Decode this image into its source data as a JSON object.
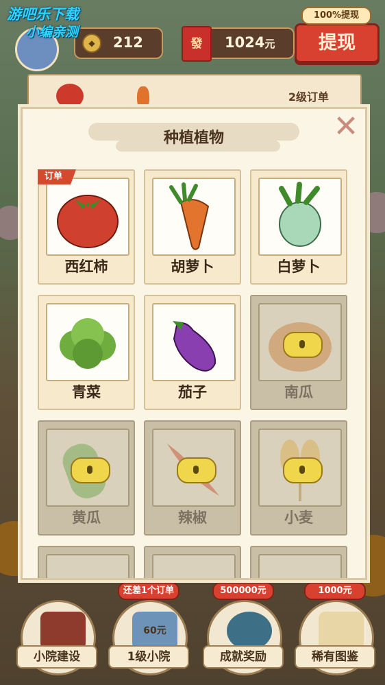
{
  "watermark": {
    "line1": "游吧乐下载",
    "line2": "小编亲测"
  },
  "header": {
    "coins": "212",
    "envelope_char": "發",
    "cash_value": "1024",
    "cash_unit": "元",
    "withdraw_tag": "100%提现",
    "withdraw_button": "提现"
  },
  "order_strip": {
    "level": "2级订单"
  },
  "modal": {
    "title": "种植植物",
    "close_symbol": "✕",
    "order_tag": "订单",
    "plants": [
      {
        "name": "西红柿",
        "locked": false,
        "color": "#d0402f"
      },
      {
        "name": "胡萝卜",
        "locked": false,
        "color": "#e2742d"
      },
      {
        "name": "白萝卜",
        "locked": false,
        "color": "#a8d8b8"
      },
      {
        "name": "青菜",
        "locked": false,
        "color": "#6fae3e"
      },
      {
        "name": "茄子",
        "locked": false,
        "color": "#8a3fb0"
      },
      {
        "name": "南瓜",
        "locked": true,
        "color": "#c98a4a"
      },
      {
        "name": "黄瓜",
        "locked": true,
        "color": "#7aa95a"
      },
      {
        "name": "辣椒",
        "locked": true,
        "color": "#c85c3c"
      },
      {
        "name": "小麦",
        "locked": true,
        "color": "#d9b15a"
      }
    ]
  },
  "nav": [
    {
      "label": "小院建设",
      "badge": ""
    },
    {
      "label": "1级小院",
      "badge": "还差1个订单",
      "price": "60元"
    },
    {
      "label": "成就奖励",
      "badge": "500000元"
    },
    {
      "label": "稀有图鉴",
      "badge": "1000元"
    }
  ]
}
